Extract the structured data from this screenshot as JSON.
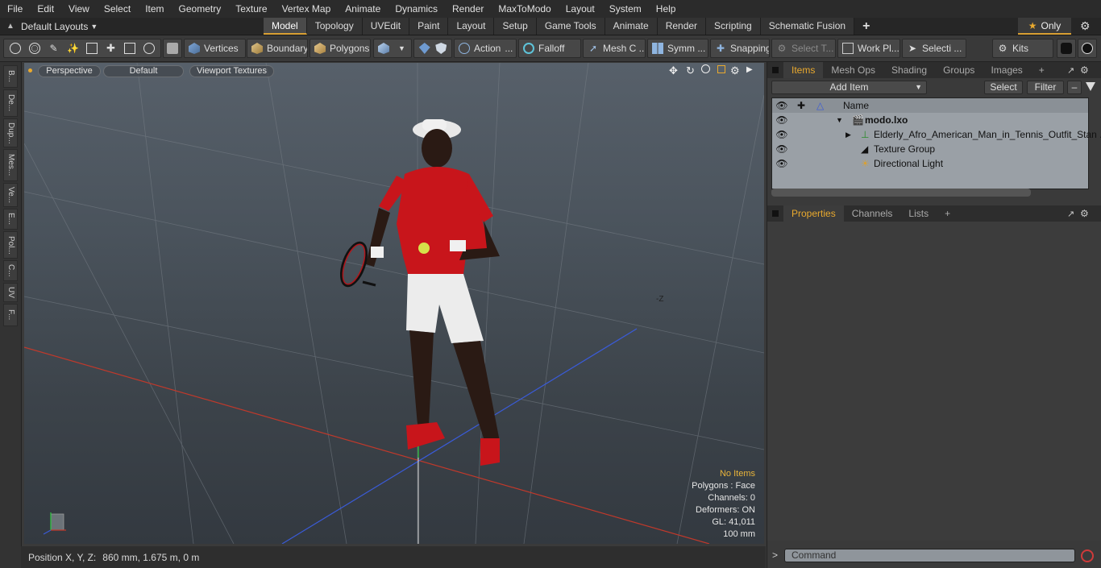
{
  "menu": [
    "File",
    "Edit",
    "View",
    "Select",
    "Item",
    "Geometry",
    "Texture",
    "Vertex Map",
    "Animate",
    "Dynamics",
    "Render",
    "MaxToModo",
    "Layout",
    "System",
    "Help"
  ],
  "layout_selector": "Default Layouts",
  "layout_tabs": [
    {
      "label": "Model",
      "active": true
    },
    {
      "label": "Topology"
    },
    {
      "label": "UVEdit"
    },
    {
      "label": "Paint"
    },
    {
      "label": "Layout"
    },
    {
      "label": "Setup"
    },
    {
      "label": "Game Tools"
    },
    {
      "label": "Animate"
    },
    {
      "label": "Render"
    },
    {
      "label": "Scripting"
    },
    {
      "label": "Schematic Fusion"
    }
  ],
  "only_label": "Only",
  "toolbar": {
    "vertices": "Vertices",
    "boundary": "Boundary",
    "polygons": "Polygons",
    "action": "Action",
    "falloff": "Falloff",
    "mesh": "Mesh C ...",
    "symm": "Symm ...",
    "snapping": "Snapping",
    "select_t": "Select T...",
    "work_pl": "Work Pl...",
    "selecti": "Selecti ...",
    "kits": "Kits"
  },
  "left_tabs": [
    "B...",
    "De...",
    "Dup...",
    "Mes...",
    "Ve...",
    "E...",
    "Pol...",
    "C...",
    "UV",
    "F..."
  ],
  "viewport": {
    "perspective": "Perspective",
    "default": "Default",
    "textures": "Viewport Textures",
    "axis_label": "-Z",
    "info": {
      "no_items": "No Items",
      "polygons": "Polygons : Face",
      "channels": "Channels: 0",
      "deformers": "Deformers: ON",
      "gl": "GL: 41,011",
      "scale": "100 mm"
    }
  },
  "status": {
    "label": "Position X, Y, Z:",
    "value": "860 mm, 1.675 m, 0 m"
  },
  "items_panel": {
    "tabs": [
      "Items",
      "Mesh Ops",
      "Shading",
      "Groups",
      "Images"
    ],
    "add_item": "Add Item",
    "select": "Select",
    "filter": "Filter",
    "name_header": "Name",
    "rows": [
      {
        "label": "modo.lxo",
        "bold": true
      },
      {
        "label": "Elderly_Afro_American_Man_in_Tennis_Outfit_Stan ..."
      },
      {
        "label": "Texture Group"
      },
      {
        "label": "Directional Light"
      }
    ]
  },
  "props_panel": {
    "tabs": [
      "Properties",
      "Channels",
      "Lists"
    ]
  },
  "command_placeholder": "Command",
  "colors": {
    "accent": "#e9a92e",
    "x_axis": "#c0392b",
    "y_axis": "#2ecc40",
    "z_axis": "#3a5bd8"
  }
}
